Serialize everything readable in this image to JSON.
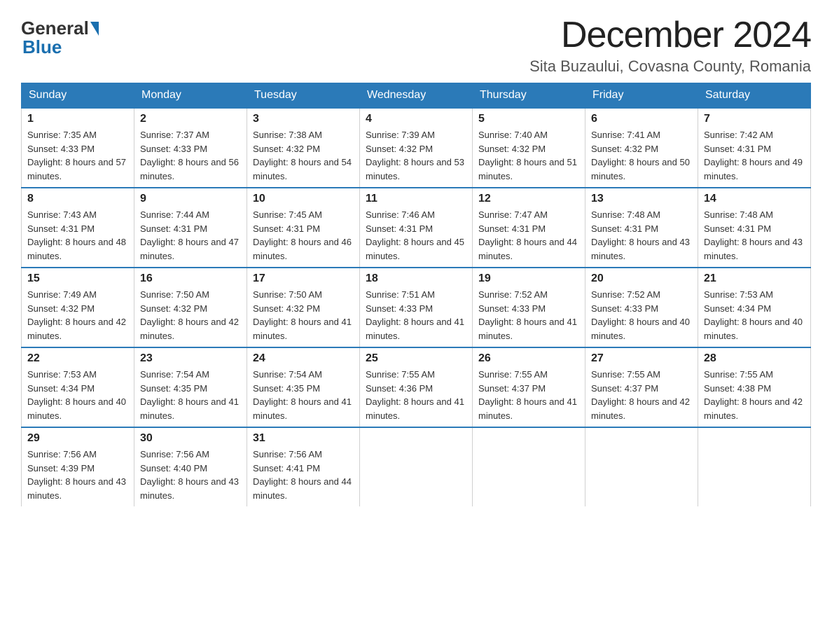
{
  "header": {
    "logo_general": "General",
    "logo_blue": "Blue",
    "month_title": "December 2024",
    "location": "Sita Buzaului, Covasna County, Romania"
  },
  "days_of_week": [
    "Sunday",
    "Monday",
    "Tuesday",
    "Wednesday",
    "Thursday",
    "Friday",
    "Saturday"
  ],
  "weeks": [
    [
      {
        "day": "1",
        "sunrise": "7:35 AM",
        "sunset": "4:33 PM",
        "daylight": "8 hours and 57 minutes."
      },
      {
        "day": "2",
        "sunrise": "7:37 AM",
        "sunset": "4:33 PM",
        "daylight": "8 hours and 56 minutes."
      },
      {
        "day": "3",
        "sunrise": "7:38 AM",
        "sunset": "4:32 PM",
        "daylight": "8 hours and 54 minutes."
      },
      {
        "day": "4",
        "sunrise": "7:39 AM",
        "sunset": "4:32 PM",
        "daylight": "8 hours and 53 minutes."
      },
      {
        "day": "5",
        "sunrise": "7:40 AM",
        "sunset": "4:32 PM",
        "daylight": "8 hours and 51 minutes."
      },
      {
        "day": "6",
        "sunrise": "7:41 AM",
        "sunset": "4:32 PM",
        "daylight": "8 hours and 50 minutes."
      },
      {
        "day": "7",
        "sunrise": "7:42 AM",
        "sunset": "4:31 PM",
        "daylight": "8 hours and 49 minutes."
      }
    ],
    [
      {
        "day": "8",
        "sunrise": "7:43 AM",
        "sunset": "4:31 PM",
        "daylight": "8 hours and 48 minutes."
      },
      {
        "day": "9",
        "sunrise": "7:44 AM",
        "sunset": "4:31 PM",
        "daylight": "8 hours and 47 minutes."
      },
      {
        "day": "10",
        "sunrise": "7:45 AM",
        "sunset": "4:31 PM",
        "daylight": "8 hours and 46 minutes."
      },
      {
        "day": "11",
        "sunrise": "7:46 AM",
        "sunset": "4:31 PM",
        "daylight": "8 hours and 45 minutes."
      },
      {
        "day": "12",
        "sunrise": "7:47 AM",
        "sunset": "4:31 PM",
        "daylight": "8 hours and 44 minutes."
      },
      {
        "day": "13",
        "sunrise": "7:48 AM",
        "sunset": "4:31 PM",
        "daylight": "8 hours and 43 minutes."
      },
      {
        "day": "14",
        "sunrise": "7:48 AM",
        "sunset": "4:31 PM",
        "daylight": "8 hours and 43 minutes."
      }
    ],
    [
      {
        "day": "15",
        "sunrise": "7:49 AM",
        "sunset": "4:32 PM",
        "daylight": "8 hours and 42 minutes."
      },
      {
        "day": "16",
        "sunrise": "7:50 AM",
        "sunset": "4:32 PM",
        "daylight": "8 hours and 42 minutes."
      },
      {
        "day": "17",
        "sunrise": "7:50 AM",
        "sunset": "4:32 PM",
        "daylight": "8 hours and 41 minutes."
      },
      {
        "day": "18",
        "sunrise": "7:51 AM",
        "sunset": "4:33 PM",
        "daylight": "8 hours and 41 minutes."
      },
      {
        "day": "19",
        "sunrise": "7:52 AM",
        "sunset": "4:33 PM",
        "daylight": "8 hours and 41 minutes."
      },
      {
        "day": "20",
        "sunrise": "7:52 AM",
        "sunset": "4:33 PM",
        "daylight": "8 hours and 40 minutes."
      },
      {
        "day": "21",
        "sunrise": "7:53 AM",
        "sunset": "4:34 PM",
        "daylight": "8 hours and 40 minutes."
      }
    ],
    [
      {
        "day": "22",
        "sunrise": "7:53 AM",
        "sunset": "4:34 PM",
        "daylight": "8 hours and 40 minutes."
      },
      {
        "day": "23",
        "sunrise": "7:54 AM",
        "sunset": "4:35 PM",
        "daylight": "8 hours and 41 minutes."
      },
      {
        "day": "24",
        "sunrise": "7:54 AM",
        "sunset": "4:35 PM",
        "daylight": "8 hours and 41 minutes."
      },
      {
        "day": "25",
        "sunrise": "7:55 AM",
        "sunset": "4:36 PM",
        "daylight": "8 hours and 41 minutes."
      },
      {
        "day": "26",
        "sunrise": "7:55 AM",
        "sunset": "4:37 PM",
        "daylight": "8 hours and 41 minutes."
      },
      {
        "day": "27",
        "sunrise": "7:55 AM",
        "sunset": "4:37 PM",
        "daylight": "8 hours and 42 minutes."
      },
      {
        "day": "28",
        "sunrise": "7:55 AM",
        "sunset": "4:38 PM",
        "daylight": "8 hours and 42 minutes."
      }
    ],
    [
      {
        "day": "29",
        "sunrise": "7:56 AM",
        "sunset": "4:39 PM",
        "daylight": "8 hours and 43 minutes."
      },
      {
        "day": "30",
        "sunrise": "7:56 AM",
        "sunset": "4:40 PM",
        "daylight": "8 hours and 43 minutes."
      },
      {
        "day": "31",
        "sunrise": "7:56 AM",
        "sunset": "4:41 PM",
        "daylight": "8 hours and 44 minutes."
      },
      null,
      null,
      null,
      null
    ]
  ]
}
